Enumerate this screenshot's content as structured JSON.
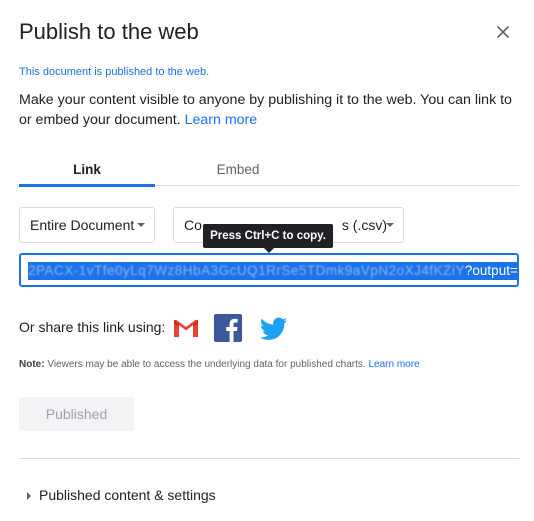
{
  "dialog": {
    "title": "Publish to the web",
    "close_icon": "close-icon",
    "published_note": "This document is published to the web.",
    "description": "Make your content visible to anyone by publishing it to the web. You can link to or embed your document.",
    "learn_more": "Learn more"
  },
  "tabs": [
    {
      "label": "Link",
      "active": true
    },
    {
      "label": "Embed",
      "active": false
    }
  ],
  "selects": {
    "document_value": "Entire Document",
    "format_prefix": "Co",
    "format_suffix": "s (.csv)"
  },
  "tooltip": "Press Ctrl+C to copy.",
  "url": {
    "obscured": "2PACX-1vTfe0yLq7Wz8HbA3GcUQ1RrSe5TDmk9aVpN2oXJ4fKZiY",
    "visible_end": "?output=csv"
  },
  "share": {
    "label": "Or share this link using:",
    "icons": [
      "gmail-icon",
      "facebook-icon",
      "twitter-icon"
    ]
  },
  "note": {
    "prefix": "Note:",
    "text": "Viewers may be able to access the underlying data for published charts.",
    "learn_more": "Learn more"
  },
  "published_button": "Published",
  "settings_label": "Published content & settings",
  "colors": {
    "accent": "#1a73e8",
    "gmail_red": "#EA4335",
    "facebook_blue": "#3B5998",
    "twitter_blue": "#1DA1F2"
  }
}
